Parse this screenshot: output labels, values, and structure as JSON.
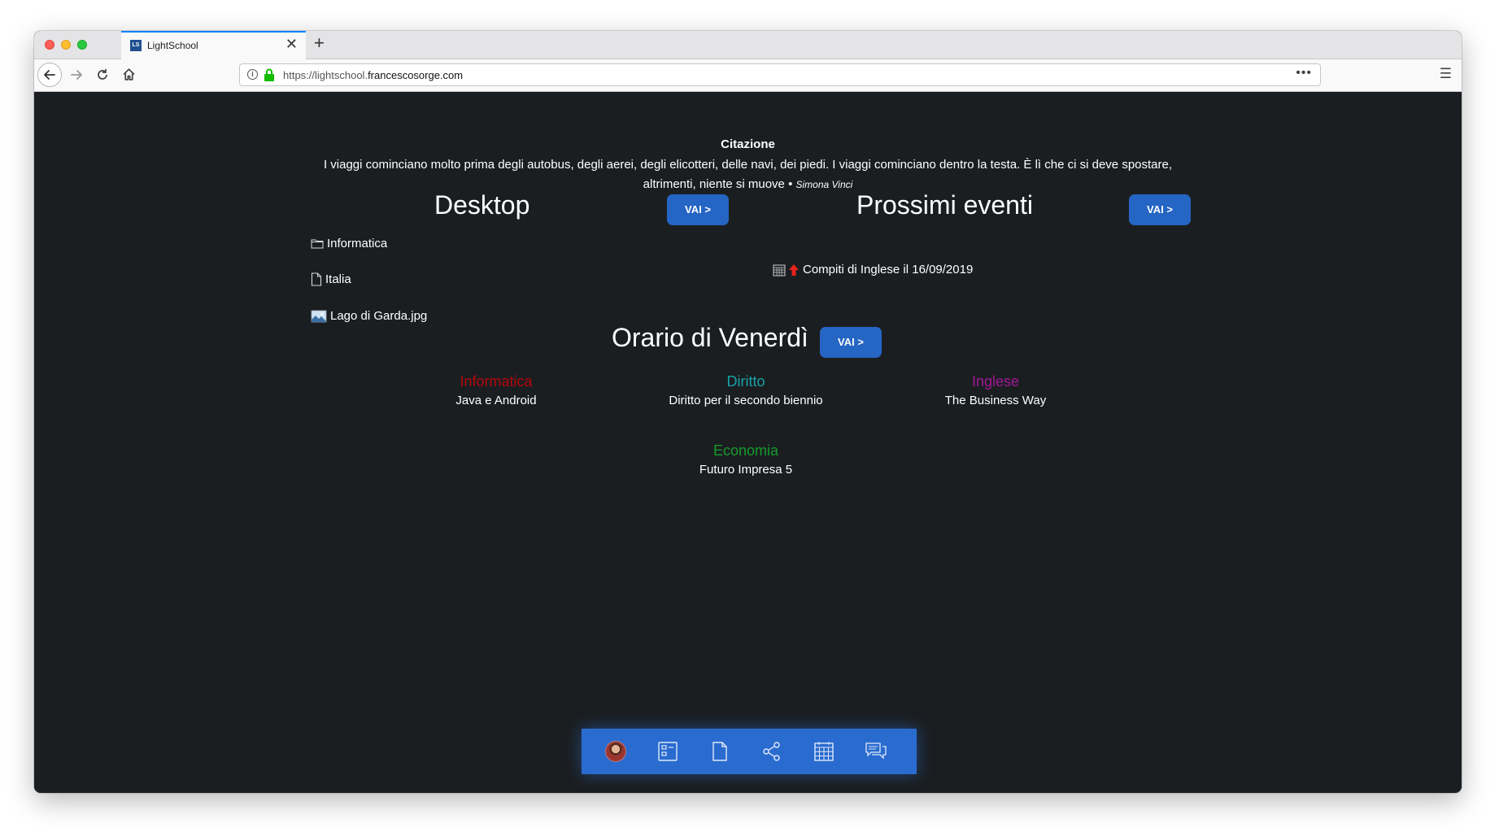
{
  "browser": {
    "tab_title": "LightSchool",
    "tab_favicon": "LS",
    "url_prefix": "https://lightschool.",
    "url_host": "francescosorge.com",
    "url_more": "•••"
  },
  "quote": {
    "title": "Citazione",
    "text": "I viaggi cominciano molto prima degli autobus, degli aerei, degli elicotteri, delle navi, dei piedi. I viaggi cominciano dentro la testa. È lì che ci si deve spostare, altrimenti, niente si muove",
    "separator": " • ",
    "author": "Simona Vinci"
  },
  "desktop": {
    "title": "Desktop",
    "button": "VAI >",
    "items": [
      {
        "label": "Informatica",
        "icon": "folder-icon"
      },
      {
        "label": "Italia",
        "icon": "document-icon"
      },
      {
        "label": "Lago di Garda.jpg",
        "icon": "image-icon"
      }
    ]
  },
  "events": {
    "title": "Prossimi eventi",
    "button": "VAI >",
    "items": [
      {
        "label": "Compiti di Inglese il 16/09/2019",
        "icons": [
          "calendar-icon",
          "priority-up-arrow-icon"
        ]
      }
    ]
  },
  "timetable": {
    "title": "Orario di Venerdì",
    "button": "VAI >",
    "entries": [
      {
        "subject": "Informatica",
        "book": "Java e Android",
        "color": "#b3060d"
      },
      {
        "subject": "Diritto",
        "book": "Diritto per il secondo biennio",
        "color": "#17a3a8"
      },
      {
        "subject": "Inglese",
        "book": "The Business Way",
        "color": "#a2179a"
      },
      {
        "subject": "Economia",
        "book": "Futuro Impresa 5",
        "color": "#169b2c"
      }
    ]
  },
  "dock": {
    "items": [
      "avatar",
      "desktop-icon",
      "file-icon",
      "share-icon",
      "calendar-icon",
      "messages-icon"
    ],
    "color": "#2a6bcf"
  },
  "colors": {
    "page_bg": "#1b1e21",
    "button_bg": "#2565c4"
  }
}
